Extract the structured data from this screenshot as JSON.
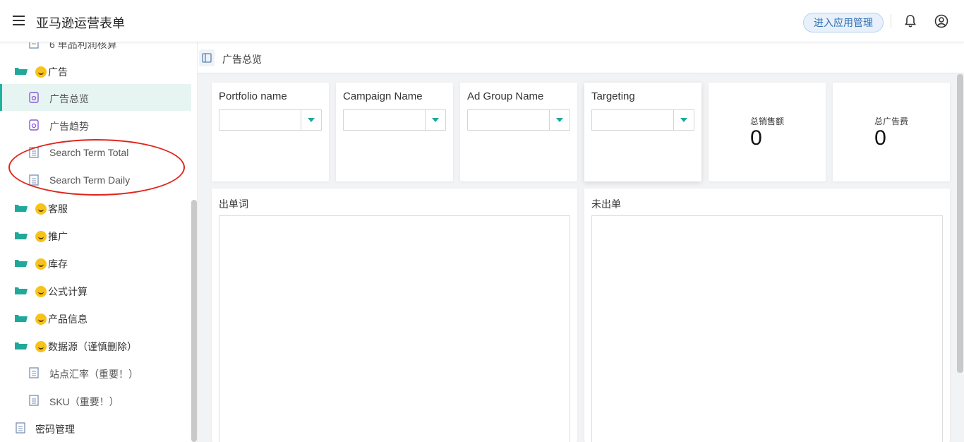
{
  "header": {
    "app_title": "亚马逊运营表单",
    "enter_app_manage": "进入应用管理"
  },
  "sidebar": {
    "items": [
      {
        "label": "6 单品利润核算",
        "type": "doc"
      },
      {
        "label": "广告",
        "type": "folder"
      },
      {
        "label": "广告总览",
        "type": "report",
        "active": true
      },
      {
        "label": "广告趋势",
        "type": "report"
      },
      {
        "label": "Search Term Total",
        "type": "doc"
      },
      {
        "label": "Search Term Daily",
        "type": "doc"
      },
      {
        "label": "客服",
        "type": "folder"
      },
      {
        "label": "推广",
        "type": "folder"
      },
      {
        "label": "库存",
        "type": "folder"
      },
      {
        "label": "公式计算",
        "type": "folder"
      },
      {
        "label": "产品信息",
        "type": "folder"
      },
      {
        "label": "数据源（谨慎删除）",
        "type": "folder"
      },
      {
        "label": "站点汇率（重要！）",
        "type": "doc"
      },
      {
        "label": "SKU（重要！）",
        "type": "doc"
      },
      {
        "label": "密码管理",
        "type": "doc"
      }
    ]
  },
  "main": {
    "page_title": "广告总览",
    "filters": [
      {
        "label": "Portfolio name",
        "value": ""
      },
      {
        "label": "Campaign Name",
        "value": ""
      },
      {
        "label": "Ad Group Name",
        "value": ""
      },
      {
        "label": "Targeting",
        "value": ""
      }
    ],
    "kpis": [
      {
        "label": "总销售额",
        "value": "0"
      },
      {
        "label": "总广告费",
        "value": "0"
      }
    ],
    "panels": [
      {
        "title": "出单词"
      },
      {
        "title": "未出单"
      }
    ]
  },
  "colors": {
    "accent": "#20b2a0",
    "annotation": "#e0241a",
    "enter_button_bg": "#e8f1fb"
  }
}
